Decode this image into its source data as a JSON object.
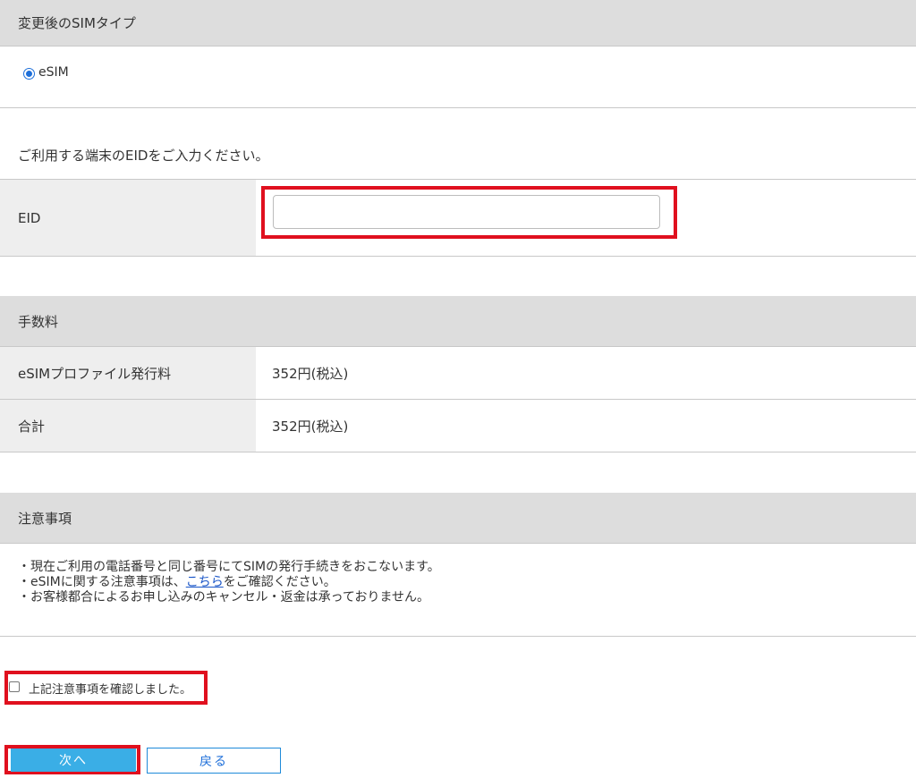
{
  "sim_type": {
    "header": "変更後のSIMタイプ",
    "option_label": "eSIM",
    "selected": true
  },
  "eid_section": {
    "instruction": "ご利用する端末のEIDをご入力ください。",
    "label": "EID",
    "value": "",
    "placeholder": ""
  },
  "fees": {
    "header": "手数料",
    "rows": [
      {
        "label": "eSIMプロファイル発行料",
        "value": "352円(税込)"
      },
      {
        "label": "合計",
        "value": "352円(税込)"
      }
    ]
  },
  "notes": {
    "header": "注意事項",
    "line1": "・現在ご利用の電話番号と同じ番号にてSIMの発行手続きをおこないます。",
    "line2_before": "・eSIMに関する注意事項は、",
    "line2_link": "こちら",
    "line2_after": "をご確認ください。",
    "line3": "・お客様都合によるお申し込みのキャンセル・返金は承っておりません。"
  },
  "confirm": {
    "label": "上記注意事項を確認しました。",
    "checked": false
  },
  "buttons": {
    "next": "次へ",
    "back": "戻る"
  },
  "colors": {
    "accent_blue": "#3aaee6",
    "highlight_red": "#e0101e",
    "header_gray": "#dddddd",
    "label_gray": "#eeeeee"
  }
}
